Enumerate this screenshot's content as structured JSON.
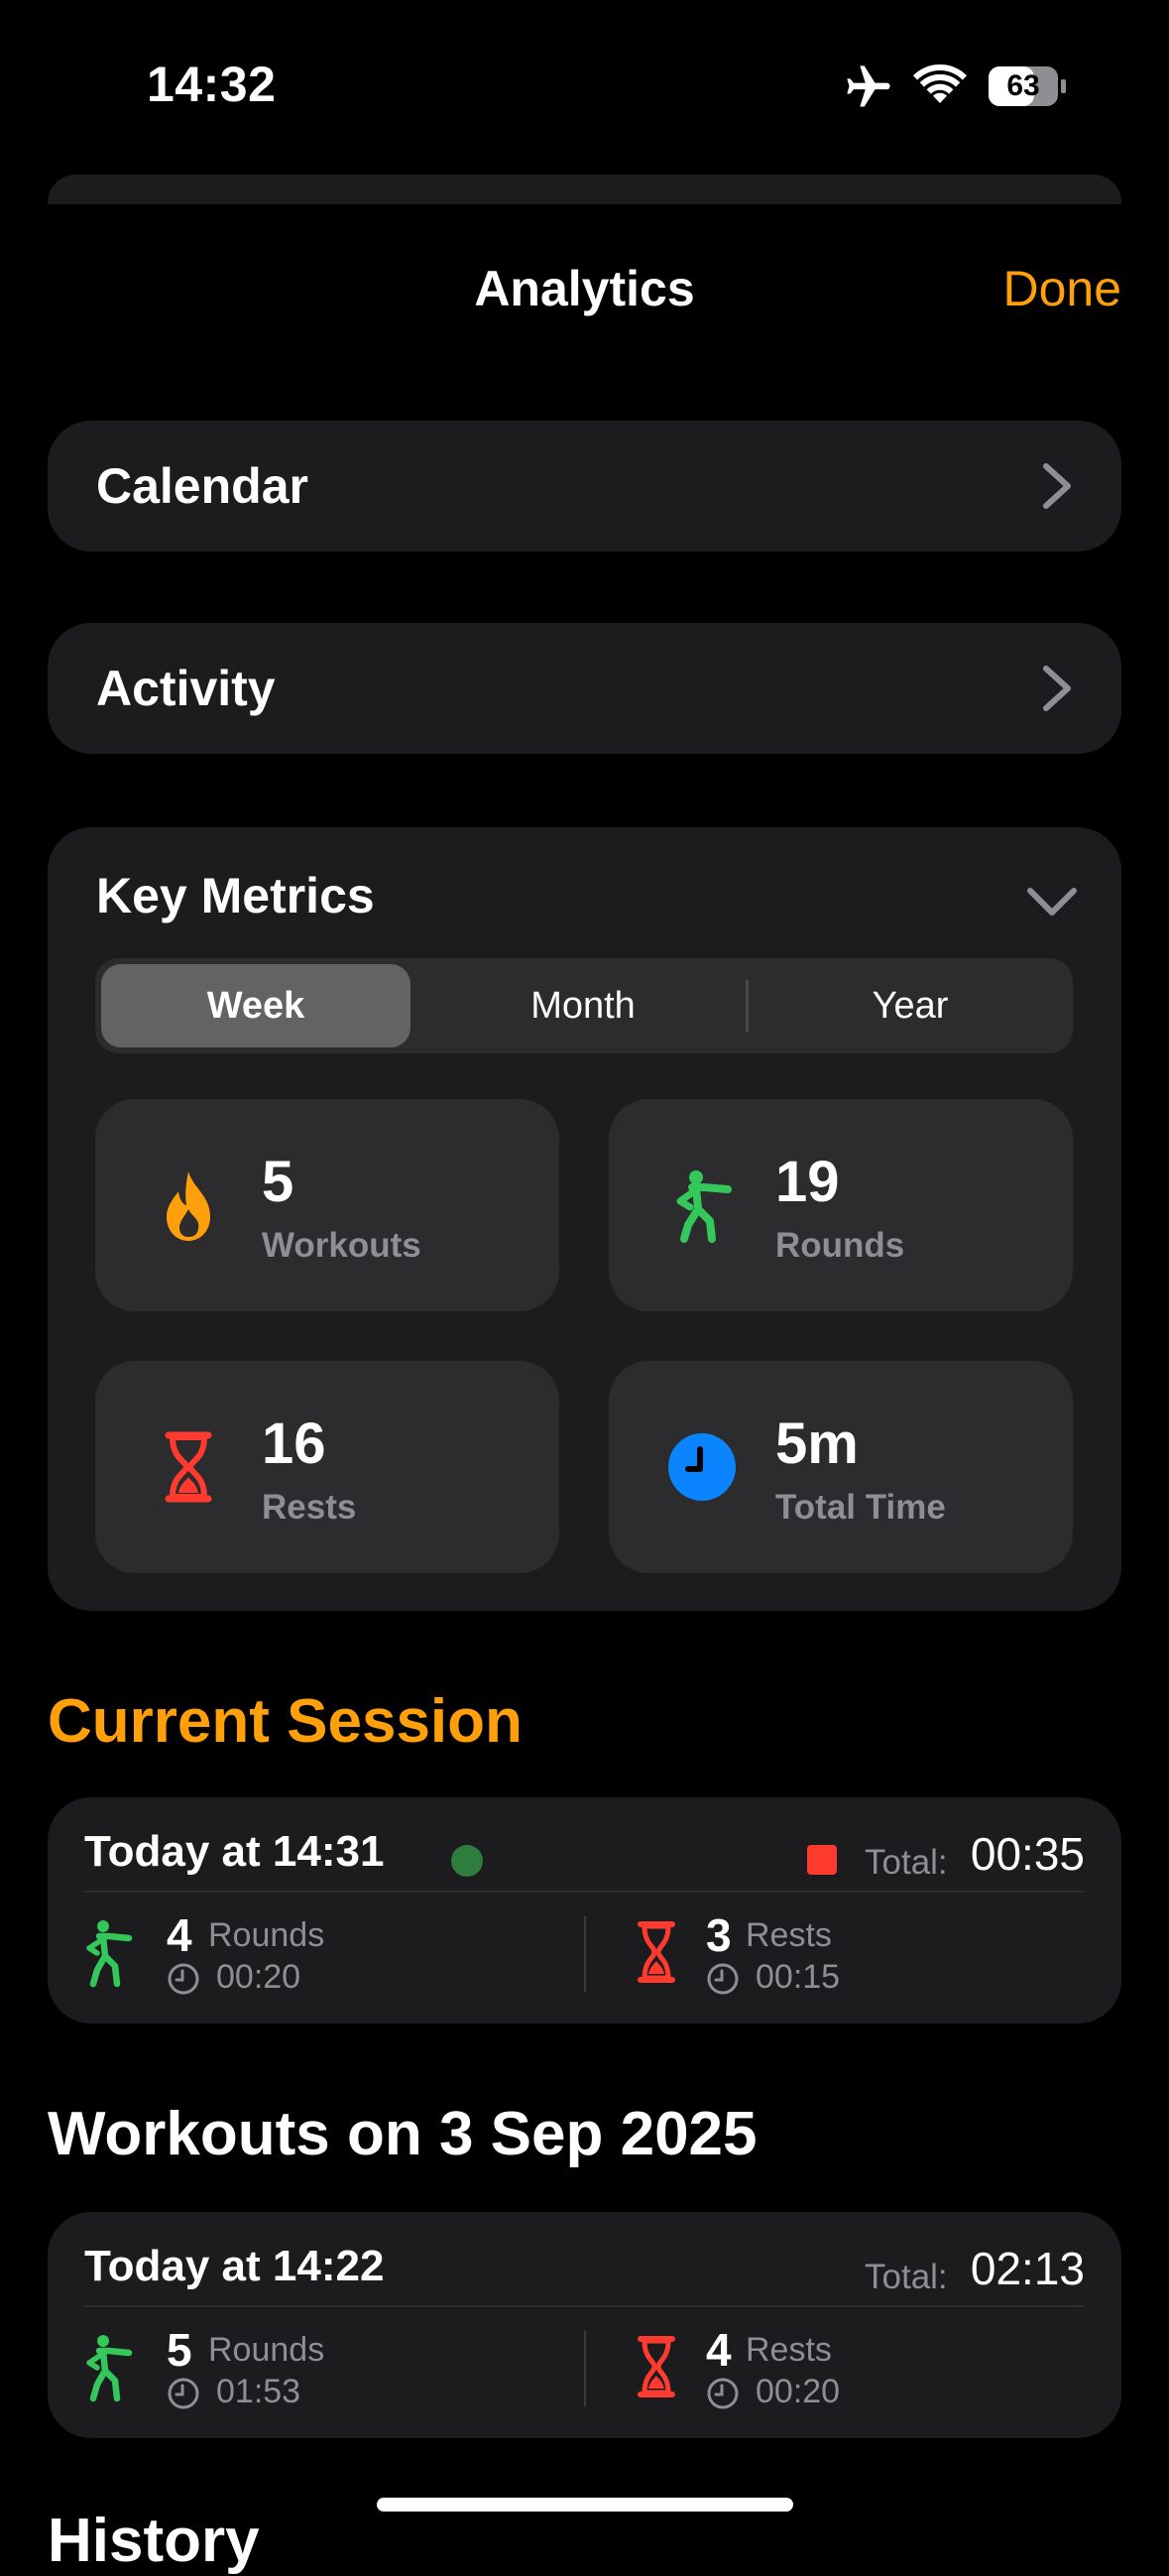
{
  "status": {
    "time": "14:32",
    "battery": "63"
  },
  "nav": {
    "title": "Analytics",
    "done": "Done"
  },
  "rows": [
    {
      "label": "Calendar"
    },
    {
      "label": "Activity"
    }
  ],
  "key_metrics": {
    "title": "Key Metrics",
    "segments": [
      "Week",
      "Month",
      "Year"
    ],
    "selected": "Week",
    "metrics": [
      {
        "value": "5",
        "label": "Workouts",
        "icon": "flame-icon",
        "color": "#ff9f0a"
      },
      {
        "value": "19",
        "label": "Rounds",
        "icon": "boxer-icon",
        "color": "#34c759"
      },
      {
        "value": "16",
        "label": "Rests",
        "icon": "hourglass-icon",
        "color": "#ff3b30"
      },
      {
        "value": "5m",
        "label": "Total Time",
        "icon": "clock-icon",
        "color": "#0a84ff"
      }
    ]
  },
  "current_session": {
    "section_title": "Current Session",
    "title": "Today at 14:31",
    "total_label": "Total:",
    "total_value": "00:35",
    "rounds_count": "4",
    "rounds_label": "Rounds",
    "rounds_time": "00:20",
    "rests_count": "3",
    "rests_label": "Rests",
    "rests_time": "00:15"
  },
  "workouts": {
    "section_title": "Workouts on 3 Sep 2025",
    "items": [
      {
        "title": "Today at 14:22",
        "total_label": "Total:",
        "total_value": "02:13",
        "rounds_count": "5",
        "rounds_label": "Rounds",
        "rounds_time": "01:53",
        "rests_count": "4",
        "rests_label": "Rests",
        "rests_time": "00:20"
      }
    ]
  },
  "history": {
    "title": "History"
  },
  "colors": {
    "accent": "#ff9f0a",
    "green": "#34c759",
    "red": "#ff3b30",
    "blue": "#0a84ff"
  }
}
